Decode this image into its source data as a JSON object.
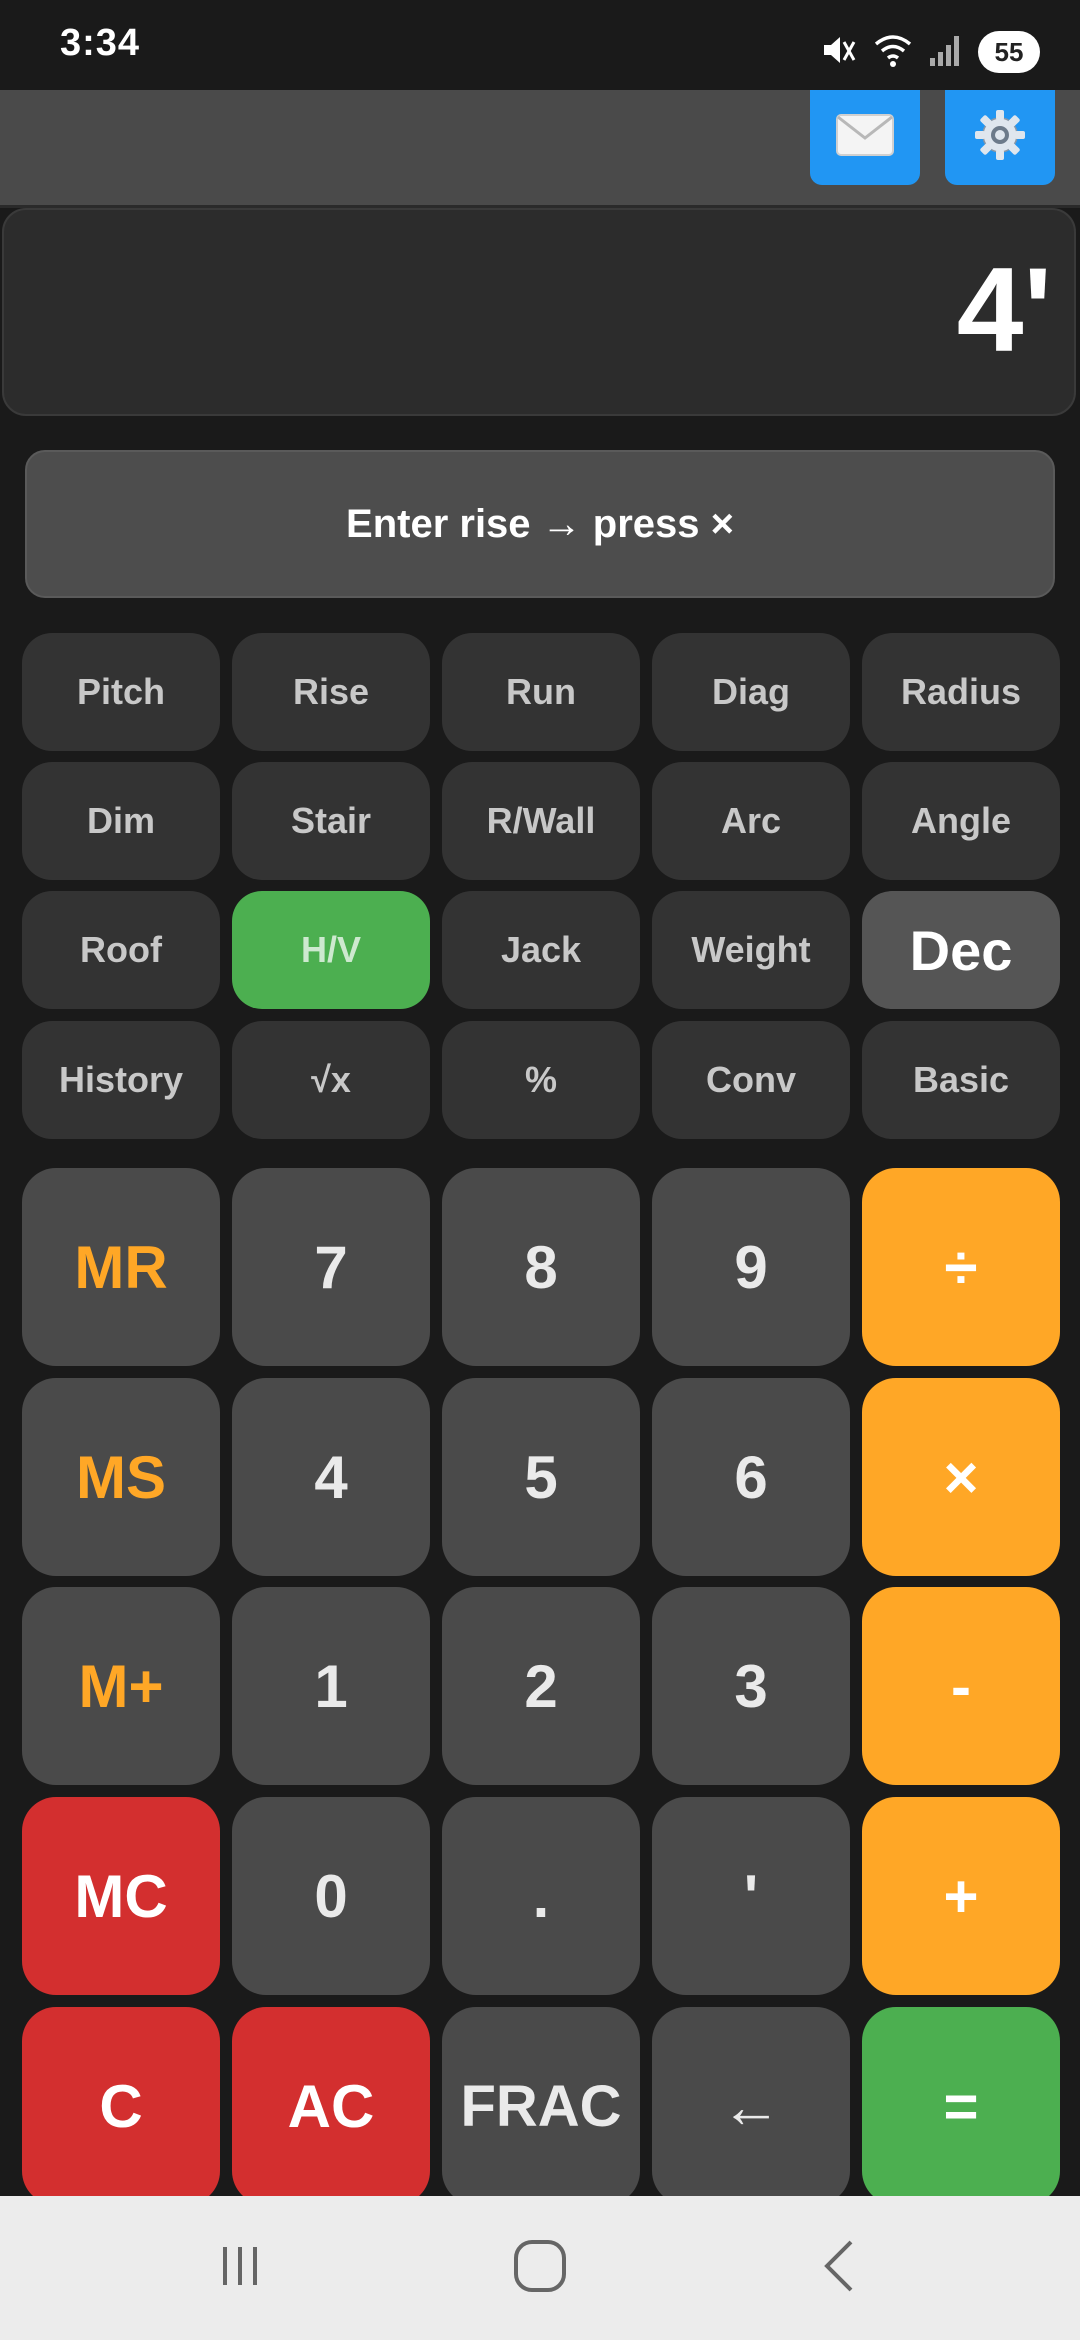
{
  "status": {
    "time": "3:34",
    "battery": "55"
  },
  "icons": {
    "mail": "mail-icon",
    "settings": "gear-icon",
    "mute": "mute-icon",
    "wifi": "wifi-icon",
    "signal": "signal-icon"
  },
  "colors": {
    "accent_blue": "#2196f3",
    "orange": "#ffa726",
    "red": "#d32f2f",
    "green": "#4caf50"
  },
  "display": {
    "value": "4'"
  },
  "hint": {
    "text": "Enter rise → press ×"
  },
  "function_keys": [
    "Pitch",
    "Rise",
    "Run",
    "Diag",
    "Radius",
    "Dim",
    "Stair",
    "R/Wall",
    "Arc",
    "Angle",
    "Roof",
    "H/V",
    "Jack",
    "Weight",
    "Dec",
    "History",
    "√x",
    "%",
    "Conv",
    "Basic"
  ],
  "active_function": "H/V",
  "keys": [
    "MR",
    "7",
    "8",
    "9",
    "÷",
    "MS",
    "4",
    "5",
    "6",
    "×",
    "M+",
    "1",
    "2",
    "3",
    "-",
    "MC",
    "0",
    ".",
    "'",
    "+",
    "C",
    "AC",
    "FRAC",
    "←",
    "="
  ]
}
